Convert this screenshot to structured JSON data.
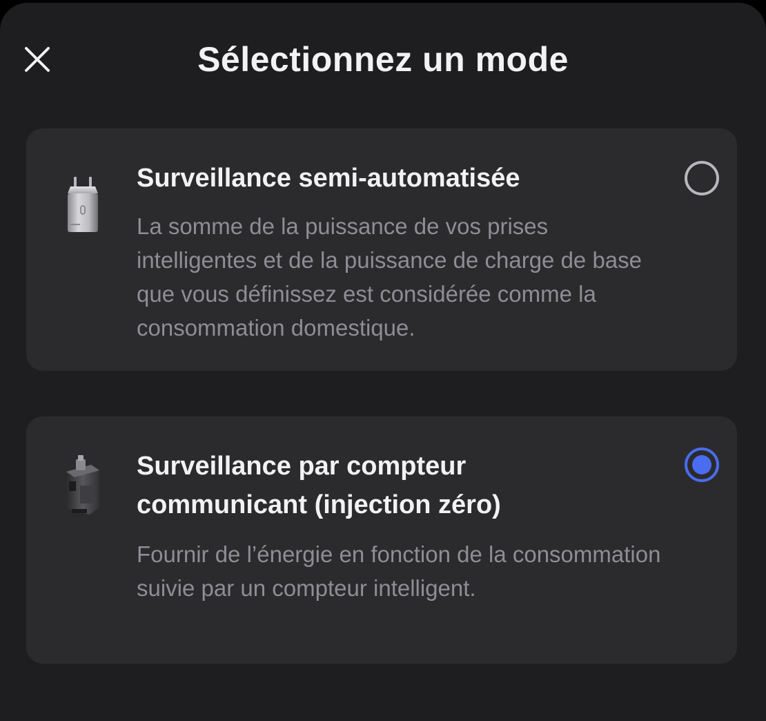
{
  "header": {
    "title": "Sélectionnez un mode",
    "close_icon": "close-icon"
  },
  "options": [
    {
      "title": "Surveillance semi-automatisée",
      "description": "La somme de la puissance de vos prises intelligentes et de la puissance de charge de base que vous définissez est considérée comme la consommation domestique.",
      "icon": "smart-plug-icon",
      "selected": false
    },
    {
      "title": "Surveillance par compteur communicant (injection zéro)",
      "description": "Fournir de l’énergie en fonction de la consommation suivie par un compteur intelligent.",
      "icon": "smart-meter-icon",
      "selected": true
    }
  ],
  "colors": {
    "background": "#1e1e20",
    "card": "#2b2b2e",
    "accent": "#4a6cf0",
    "title_text": "#f2f2f4",
    "secondary_text": "#8e8e93"
  }
}
